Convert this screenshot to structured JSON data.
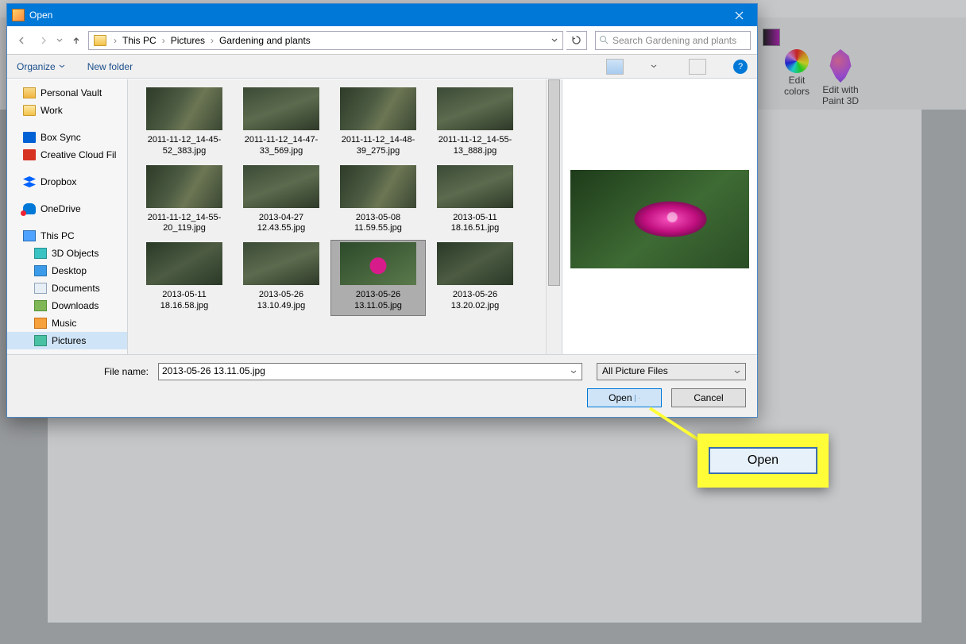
{
  "dialog": {
    "title": "Open",
    "breadcrumb": {
      "root": "This PC",
      "mid": "Pictures",
      "leaf": "Gardening and plants"
    },
    "search_placeholder": "Search Gardening and plants",
    "toolbar": {
      "organize": "Organize",
      "newfolder": "New folder"
    },
    "tree": [
      {
        "key": "pv",
        "label": "Personal Vault",
        "cls": "vault"
      },
      {
        "key": "work",
        "label": "Work",
        "cls": "folder"
      },
      {
        "key": "box",
        "label": "Box Sync",
        "cls": "box"
      },
      {
        "key": "cc",
        "label": "Creative Cloud Fil",
        "cls": "cc"
      },
      {
        "key": "dbx",
        "label": "Dropbox",
        "cls": "dbox"
      },
      {
        "key": "od",
        "label": "OneDrive",
        "cls": "cloud"
      },
      {
        "key": "pc",
        "label": "This PC",
        "cls": "pc"
      },
      {
        "key": "o3d",
        "label": "3D Objects",
        "cls": "obj3d",
        "sub": true
      },
      {
        "key": "desk",
        "label": "Desktop",
        "cls": "desk",
        "sub": true
      },
      {
        "key": "docs",
        "label": "Documents",
        "cls": "docs",
        "sub": true
      },
      {
        "key": "down",
        "label": "Downloads",
        "cls": "down",
        "sub": true
      },
      {
        "key": "mus",
        "label": "Music",
        "cls": "music",
        "sub": true
      },
      {
        "key": "pics",
        "label": "Pictures",
        "cls": "pics",
        "sub": true,
        "selected": true
      }
    ],
    "files": [
      {
        "name": "2011-11-12_14-45-52_383.jpg",
        "t": "t1"
      },
      {
        "name": "2011-11-12_14-47-33_569.jpg",
        "t": "t2"
      },
      {
        "name": "2011-11-12_14-48-39_275.jpg",
        "t": "t1"
      },
      {
        "name": "2011-11-12_14-55-13_888.jpg",
        "t": "t2"
      },
      {
        "name": "2011-11-12_14-55-20_119.jpg",
        "t": "t1"
      },
      {
        "name": "2013-04-27 12.43.55.jpg",
        "t": "t2"
      },
      {
        "name": "2013-05-08 11.59.55.jpg",
        "t": "t1"
      },
      {
        "name": "2013-05-11 18.16.51.jpg",
        "t": "t2"
      },
      {
        "name": "2013-05-11 18.16.58.jpg",
        "t": "t4"
      },
      {
        "name": "2013-05-26 13.10.49.jpg",
        "t": "t2"
      },
      {
        "name": "2013-05-26 13.11.05.jpg",
        "t": "t3",
        "selected": true
      },
      {
        "name": "2013-05-26 13.20.02.jpg",
        "t": "t4"
      }
    ],
    "filename_label": "File name:",
    "filename": "2013-05-26 13.11.05.jpg",
    "filter": "All Picture Files",
    "open_btn": "Open",
    "cancel_btn": "Cancel"
  },
  "bg": {
    "edit_colors": "Edit\ncolors",
    "edit_3d": "Edit with\nPaint 3D"
  },
  "callout": {
    "label": "Open"
  }
}
